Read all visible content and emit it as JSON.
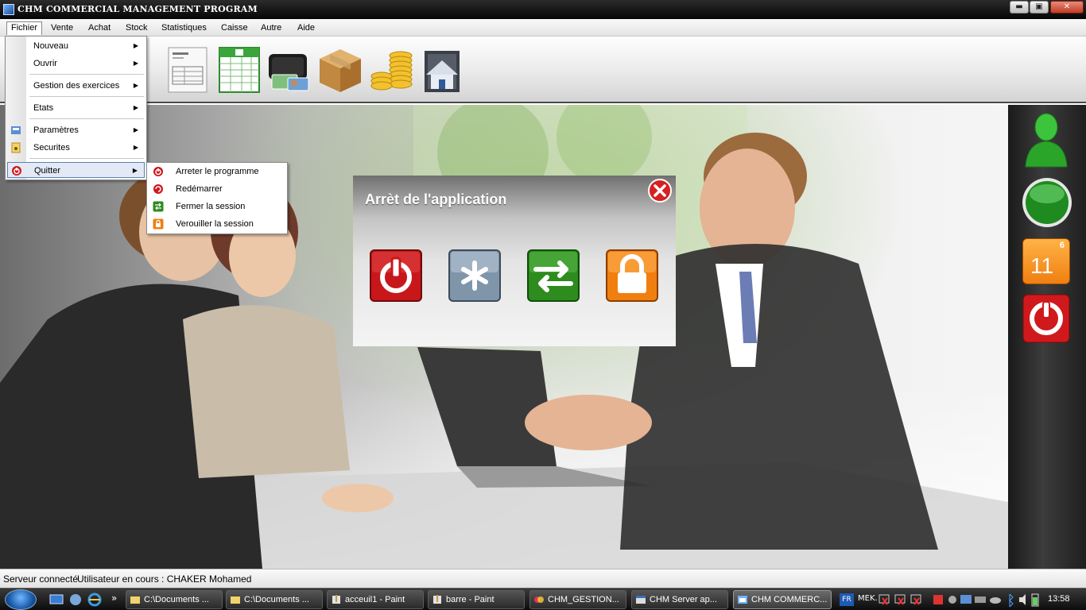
{
  "window": {
    "title": "CHM COMMERCIAL MANAGEMENT PROGRAM",
    "min": "▬",
    "max": "▣",
    "close": "✕"
  },
  "menubar": {
    "items": [
      "Fichier",
      "Vente",
      "Achat",
      "Stock",
      "Statistiques",
      "Caisse",
      "Autre",
      "Aide"
    ]
  },
  "fichier_menu": {
    "items": [
      {
        "label": "Nouveau",
        "arrow": "▶"
      },
      {
        "label": "Ouvrir",
        "arrow": "▶"
      },
      {
        "label": "Gestion des exercices",
        "arrow": "▶"
      },
      {
        "label": "Etats",
        "arrow": "▶"
      },
      {
        "label": "Paramètres",
        "arrow": "▶"
      },
      {
        "label": "Securites",
        "arrow": "▶"
      },
      {
        "label": "Quitter",
        "arrow": "▶"
      }
    ]
  },
  "quitter_menu": {
    "items": [
      {
        "label": "Arreter le programme"
      },
      {
        "label": "Redémarrer"
      },
      {
        "label": "Fermer la session"
      },
      {
        "label": "Verouiller la session"
      }
    ]
  },
  "toolbar": {
    "icons": [
      "invoice-icon",
      "spreadsheet-icon",
      "wallet-icon",
      "box-icon",
      "coins-icon",
      "home-icon"
    ]
  },
  "dialog": {
    "title": "Arrèt de l'application"
  },
  "right_panel": {
    "calendar_month": "6",
    "calendar_day": "11"
  },
  "statusbar": {
    "server": "Serveur connecté",
    "user": "Utilisateur en cours : CHAKER Mohamed"
  },
  "taskbar": {
    "tasks": [
      "C:\\Documents ...",
      "C:\\Documents ...",
      "acceuil1 - Paint",
      "barre - Paint",
      "CHM_GESTION...",
      "CHM Server ap...",
      "CHM COMMERC..."
    ],
    "lang": "FR",
    "tray_text": "MEK.",
    "clock": "13:58",
    "quick_launch_arrow": "»"
  },
  "colors": {
    "accent_red": "#c8171b",
    "accent_green": "#2e8b1e",
    "accent_orange": "#f07f10",
    "accent_steel": "#7f95aa"
  }
}
